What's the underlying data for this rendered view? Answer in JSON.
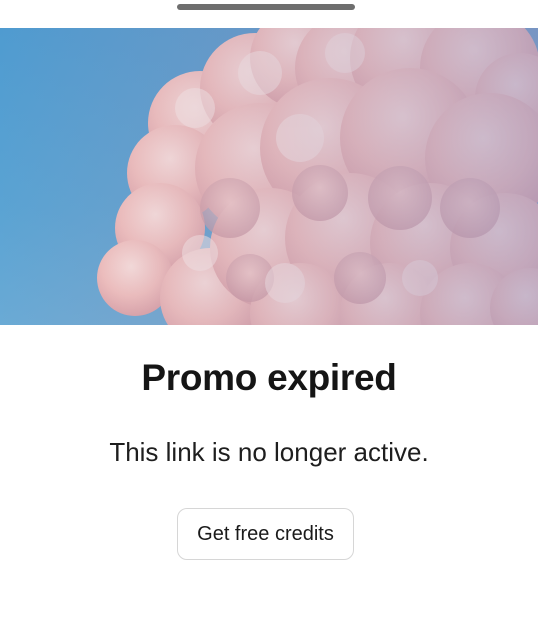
{
  "sheet": {
    "title": "Promo expired",
    "message": "This link is no longer active.",
    "cta_label": "Get free credits"
  },
  "colors": {
    "sky": "#4f9bd0",
    "cloud": "#f2c4c2",
    "title_text": "#151515",
    "button_border": "#d6d6d6"
  },
  "icons": {
    "drag_handle": "sheet-grabber",
    "hero_image": "pink-clouds-illustration"
  }
}
